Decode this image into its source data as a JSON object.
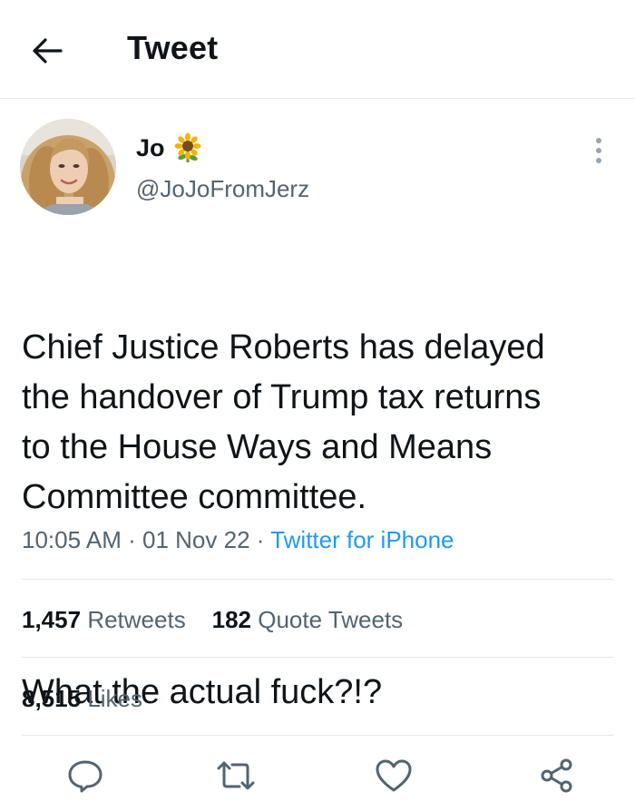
{
  "header": {
    "title": "Tweet"
  },
  "tweet": {
    "author_name": "Jo",
    "handle": "@JoJoFromJerz",
    "text_paragraph_1": "Chief Justice Roberts has delayed\nthe handover of Trump tax returns\nto the House Ways and Means\nCommittee committee.",
    "text_paragraph_2": "What the actual fuck?!?",
    "time": "10:05 AM",
    "date": "01 Nov 22",
    "source": "Twitter for iPhone",
    "separator": "·"
  },
  "stats": {
    "retweets_count": "1,457",
    "retweets_label": "Retweets",
    "quotes_count": "182",
    "quotes_label": "Quote Tweets",
    "likes_count": "8,515",
    "likes_label": "Likes"
  },
  "icons": {
    "back": "arrow-left-icon",
    "more": "more-vertical-icon",
    "reply": "reply-icon",
    "retweet": "retweet-icon",
    "like": "heart-icon",
    "share": "share-icon",
    "emoji": "sunflower-icon"
  },
  "colors": {
    "text": "#0f1419",
    "secondary": "#536471",
    "accent": "#1d9bf0",
    "divider": "#e7e7e7"
  }
}
